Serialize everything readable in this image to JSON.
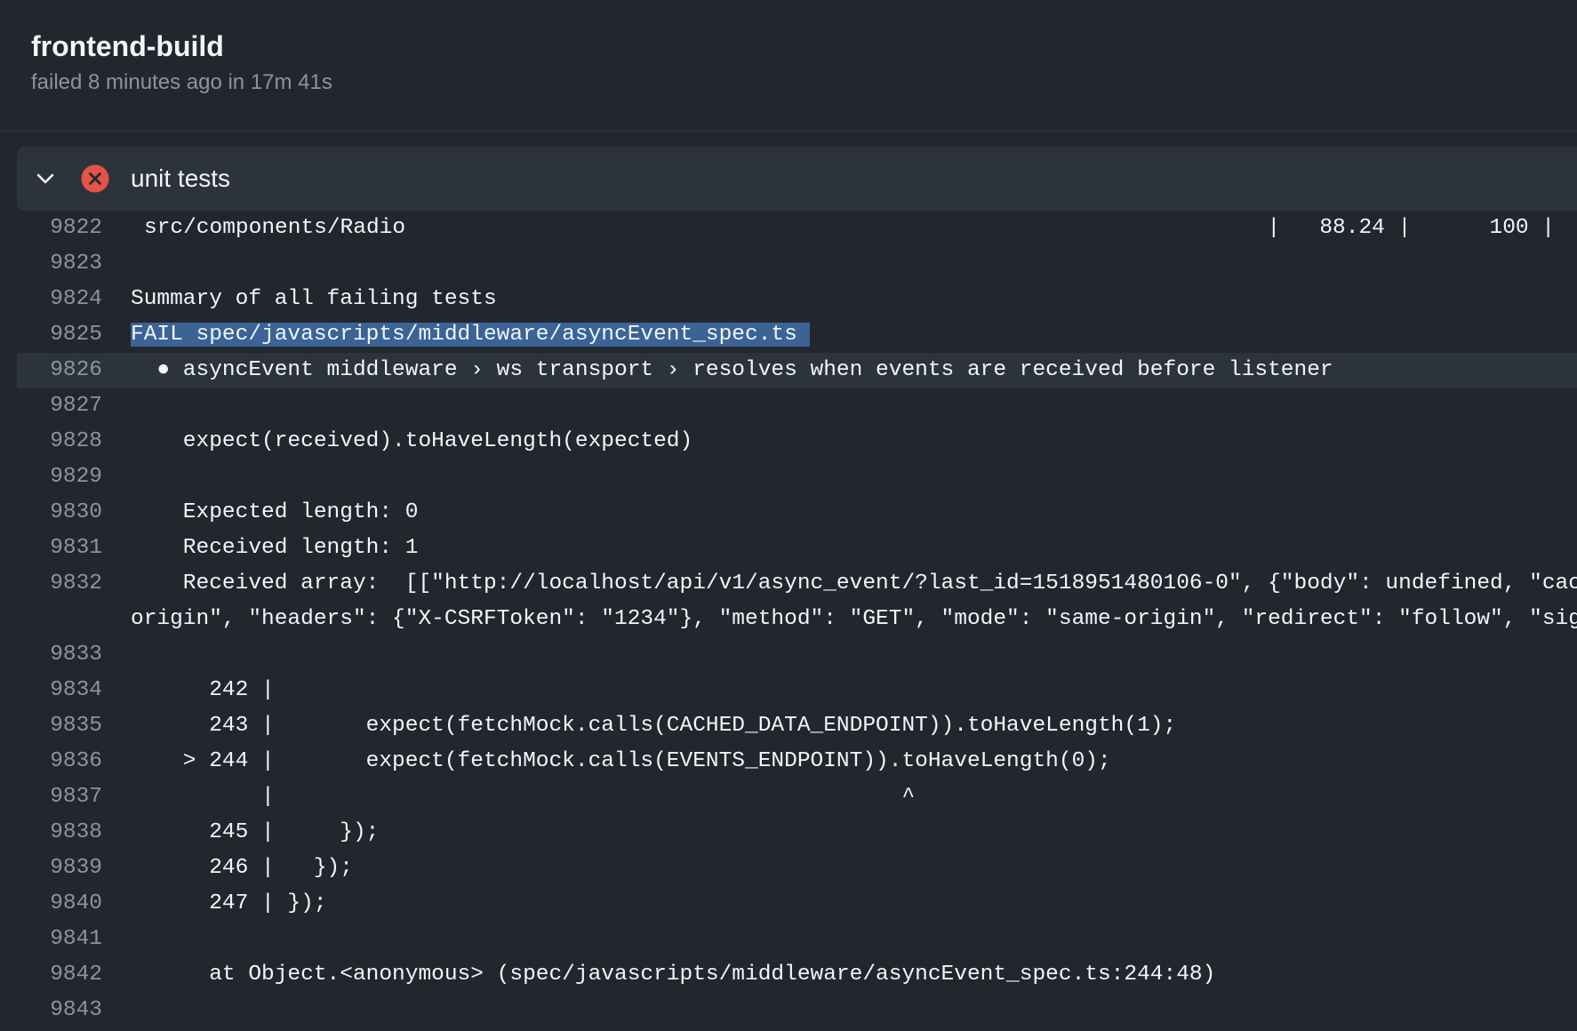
{
  "job": {
    "title": "frontend-build",
    "status_text": "failed 8 minutes ago in 17m 41s"
  },
  "step": {
    "name": "unit tests",
    "status": "failed",
    "icon": "x-circle-icon",
    "expand_icon": "chevron-down-icon"
  },
  "colors": {
    "background": "#22272e",
    "panel": "#2d333b",
    "fail": "#e5534b",
    "selection": "#3b6396",
    "muted": "#8b949e",
    "text": "#f0f6fc"
  },
  "log": {
    "lines": [
      {
        "num": "9822",
        "text": "src/components/Radio",
        "right_text": "|   88.24 |      100 |"
      },
      {
        "num": "9823",
        "text": ""
      },
      {
        "num": "9824",
        "text": "Summary of all failing tests"
      },
      {
        "num": "9825",
        "text": "FAIL spec/javascripts/middleware/asyncEvent_spec.ts"
      },
      {
        "num": "9826",
        "text": "  ● asyncEvent middleware › ws transport › resolves when events are received before listener"
      },
      {
        "num": "9827",
        "text": ""
      },
      {
        "num": "9828",
        "text": "    expect(received).toHaveLength(expected)"
      },
      {
        "num": "9829",
        "text": ""
      },
      {
        "num": "9830",
        "text": "    Expected length: 0"
      },
      {
        "num": "9831",
        "text": "    Received length: 1"
      },
      {
        "num": "9832",
        "text": "    Received array:  [[\"http://localhost/api/v1/async_event/?last_id=1518951480106-0\", {\"body\": undefined, \"cache",
        "text_cont": "origin\", \"headers\": {\"X-CSRFToken\": \"1234\"}, \"method\": \"GET\", \"mode\": \"same-origin\", \"redirect\": \"follow\", \"signa"
      },
      {
        "num": "9833",
        "text": ""
      },
      {
        "num": "9834",
        "text": "      242 |"
      },
      {
        "num": "9835",
        "text": "      243 |       expect(fetchMock.calls(CACHED_DATA_ENDPOINT)).toHaveLength(1);"
      },
      {
        "num": "9836",
        "text": "    > 244 |       expect(fetchMock.calls(EVENTS_ENDPOINT)).toHaveLength(0);"
      },
      {
        "num": "9837",
        "text": "          |                                                ^"
      },
      {
        "num": "9838",
        "text": "      245 |     });"
      },
      {
        "num": "9839",
        "text": "      246 |   });"
      },
      {
        "num": "9840",
        "text": "      247 | });"
      },
      {
        "num": "9841",
        "text": ""
      },
      {
        "num": "9842",
        "text": "      at Object.<anonymous> (spec/javascripts/middleware/asyncEvent_spec.ts:244:48)"
      },
      {
        "num": "9843",
        "text": ""
      }
    ]
  }
}
